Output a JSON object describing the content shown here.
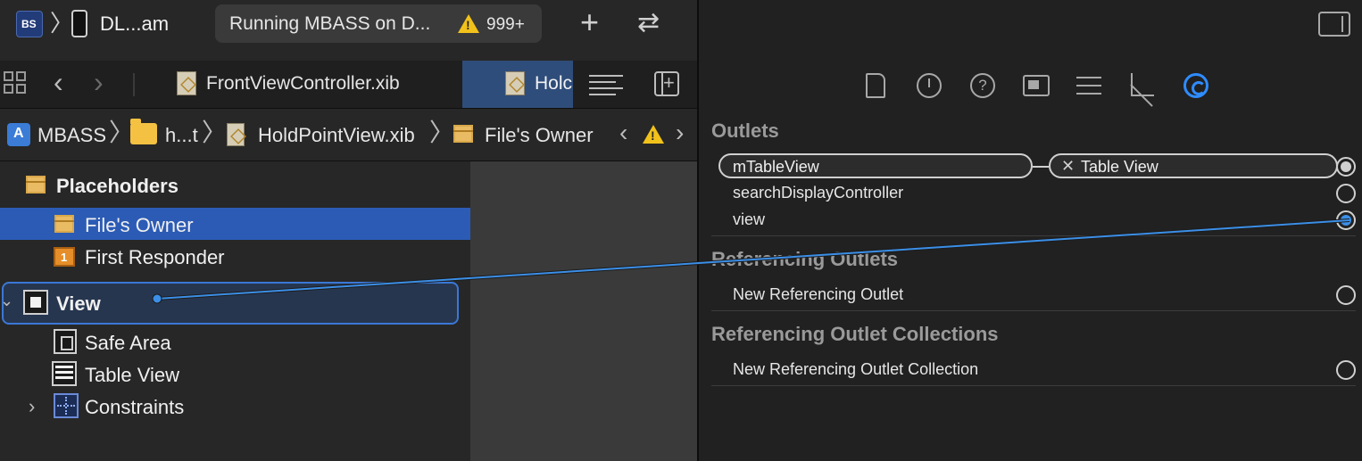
{
  "toolbar": {
    "scheme_icon_text": "BS",
    "device_name": "DL...am",
    "status_text": "Running MBASS on D...",
    "warning_count": "999+"
  },
  "tabs": [
    {
      "label": "FrontViewController.xib",
      "active": false
    },
    {
      "label": "Holc",
      "active": true
    }
  ],
  "jump_bar": {
    "project": "MBASS",
    "folder": "h...t",
    "file": "HoldPointView.xib",
    "object": "File's Owner"
  },
  "outline": {
    "placeholders_label": "Placeholders",
    "files_owner_label": "File's Owner",
    "first_responder_label": "First Responder",
    "view_label": "View",
    "safe_area_label": "Safe Area",
    "table_view_label": "Table View",
    "constraints_label": "Constraints"
  },
  "inspector": {
    "outlets_header": "Outlets",
    "outlets": [
      {
        "name": "mTableView",
        "connected_to": "Table View",
        "state": "connected"
      },
      {
        "name": "searchDisplayController",
        "state": "empty"
      },
      {
        "name": "view",
        "state": "dragging"
      }
    ],
    "referencing_outlets_header": "Referencing Outlets",
    "new_referencing_outlet": "New Referencing Outlet",
    "referencing_collections_header": "Referencing Outlet Collections",
    "new_referencing_collection": "New Referencing Outlet Collection"
  },
  "colors": {
    "selection": "#2b5bb5",
    "accent": "#2f8cff",
    "warning": "#f2c21b",
    "connection_line": "#3b8fe8"
  }
}
